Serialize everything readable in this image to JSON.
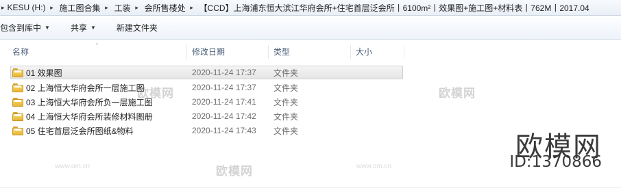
{
  "breadcrumb": {
    "items": [
      "KESU (H:)",
      "施工图合集",
      "工装",
      "会所售楼处",
      "【CCD】上海浦东恒大滨江华府会所+住宅首层泛会所丨6100m²丨效果图+施工图+材料表丨762M丨2017.04"
    ]
  },
  "toolbar": {
    "include_in_library": "包含到库中",
    "share": "共享",
    "new_folder": "新建文件夹"
  },
  "columns": {
    "name": "名称",
    "date_modified": "修改日期",
    "type": "类型",
    "size": "大小"
  },
  "files": [
    {
      "name": "01 效果图",
      "date": "2020-11-24 17:37",
      "type": "文件夹",
      "selected": true
    },
    {
      "name": "02 上海恒大华府会所一层施工图",
      "date": "2020-11-24 17:37",
      "type": "文件夹",
      "selected": false
    },
    {
      "name": "03 上海恒大华府会所负一层施工图",
      "date": "2020-11-24 17:41",
      "type": "文件夹",
      "selected": false
    },
    {
      "name": "04 上海恒大华府会所装修材料图册",
      "date": "2020-11-24 17:42",
      "type": "文件夹",
      "selected": false
    },
    {
      "name": "05 住宅首层泛会所图纸&物料",
      "date": "2020-11-24 17:43",
      "type": "文件夹",
      "selected": false
    }
  ],
  "watermark": {
    "brand": "欧模网",
    "id": "ID:1370866",
    "small_text": "欧模网",
    "url_text": "www.om.cn"
  },
  "colors": {
    "selection_bg": "#e6e6e6",
    "folder_yellow": "#f0c24a",
    "header_text": "#4c607a"
  }
}
